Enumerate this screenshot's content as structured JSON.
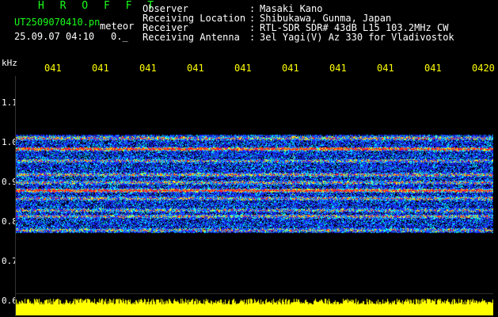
{
  "header": {
    "title": "H R O F F T",
    "filename": "UT2509070410.pn",
    "file_type": "meteor",
    "datetime": "25.09.07 04:10",
    "value": "0._",
    "fields": [
      {
        "label": "Observer",
        "colon": ":",
        "value": "Masaki Kano"
      },
      {
        "label": "Receiving Location",
        "colon": ":",
        "value": "Shibukawa, Gunma, Japan"
      },
      {
        "label": "Receiver",
        "colon": ":",
        "value": "RTL-SDR SDR# 43dB L15 103.2MHz CW"
      },
      {
        "label": "Receiving Antenna",
        "colon": ":",
        "value": "3el Yagi(V) Az 330 for Vladivostok"
      }
    ]
  },
  "chart_data": {
    "type": "heatmap",
    "ylabel": "kHz",
    "yticks": [
      "1.1",
      "1.0",
      "0.9",
      "0.8",
      "0.7",
      "0.6"
    ],
    "xticks": [
      "041",
      "041",
      "041",
      "041",
      "041",
      "041",
      "041",
      "041",
      "041",
      "0420"
    ],
    "ylim": [
      0.6,
      1.1
    ],
    "signal_band_khz": [
      0.775,
      1.02
    ],
    "strong_lines_khz": [
      0.985,
      0.88
    ],
    "colors": {
      "background": "#000000",
      "noise": "#1a2cff",
      "mid": "#00ffff",
      "high": "#ffff00",
      "peak": "#ff2020",
      "level_bar": "#ffff00"
    }
  }
}
